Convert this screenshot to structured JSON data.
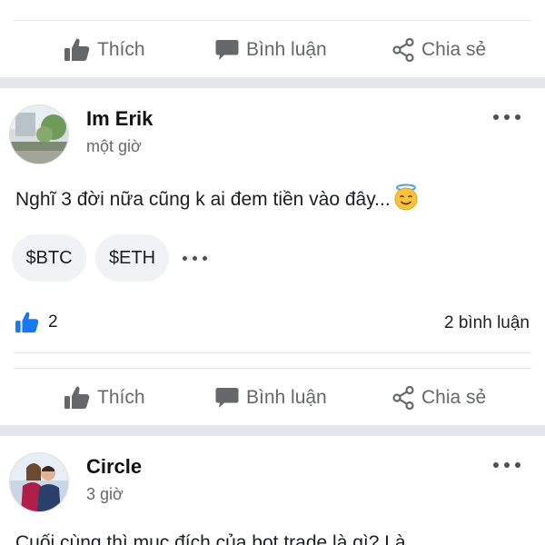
{
  "actions": {
    "like": "Thích",
    "comment": "Bình luận",
    "share": "Chia sẻ"
  },
  "posts": [
    {
      "author": "Im Erik",
      "time": "một giờ",
      "content": "Nghĩ 3 đời nữa cũng k ai đem tiền vào đây...",
      "emoji": "smiling-face-with-halo",
      "tags": [
        "$BTC",
        "$ETH"
      ],
      "likes": "2",
      "comments": "2 bình luận"
    },
    {
      "author": "Circle",
      "time": "3 giờ",
      "content": "Cuối cùng thì mục đích của bot trade là gì? Là"
    }
  ],
  "colors": {
    "accent": "#1877f2",
    "muted": "#65676b",
    "separator": "#e4e6eb",
    "chip": "#f0f2f5"
  },
  "icons": [
    "thumbs-up-icon",
    "comment-bubble-icon",
    "share-icon",
    "more-icon",
    "halo-emoji-icon"
  ]
}
